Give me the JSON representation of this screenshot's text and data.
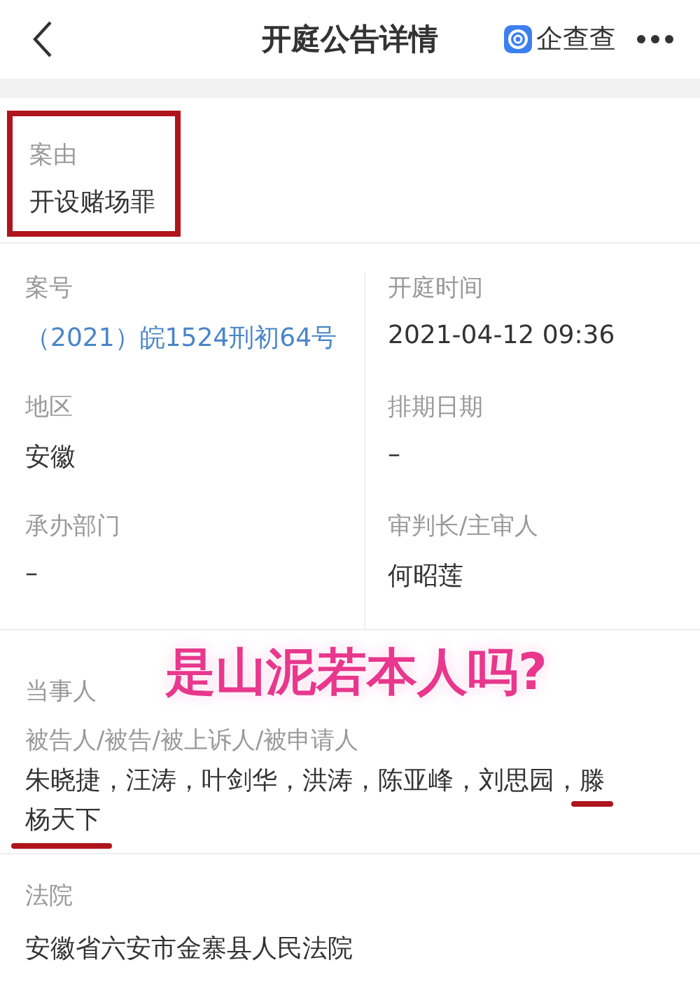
{
  "header": {
    "title": "开庭公告详情",
    "brand": "企查查"
  },
  "cause": {
    "label": "案由",
    "value": "开设赌场罪",
    "highlighted": true
  },
  "fields": [
    {
      "label": "案号",
      "value": "（2021）皖1524刑初64号",
      "kind": "link"
    },
    {
      "label": "开庭时间",
      "value": "2021-04-12 09:36",
      "kind": "text"
    },
    {
      "label": "地区",
      "value": "安徽",
      "kind": "text"
    },
    {
      "label": "排期日期",
      "value": "–",
      "kind": "text"
    },
    {
      "label": "承办部门",
      "value": "–",
      "kind": "text"
    },
    {
      "label": "审判长/主审人",
      "value": "何昭莲",
      "kind": "text"
    }
  ],
  "parties": {
    "label": "当事人",
    "role": "被告人/被告/被上诉人/被申请人",
    "names": "朱晓捷，汪涛，叶剑华，洪涛，陈亚峰，刘思园，滕杨天下",
    "underlined": true
  },
  "court": {
    "label": "法院",
    "value": "安徽省六安市金寨县人民法院"
  },
  "overlay_caption": "是山泥若本人吗?"
}
